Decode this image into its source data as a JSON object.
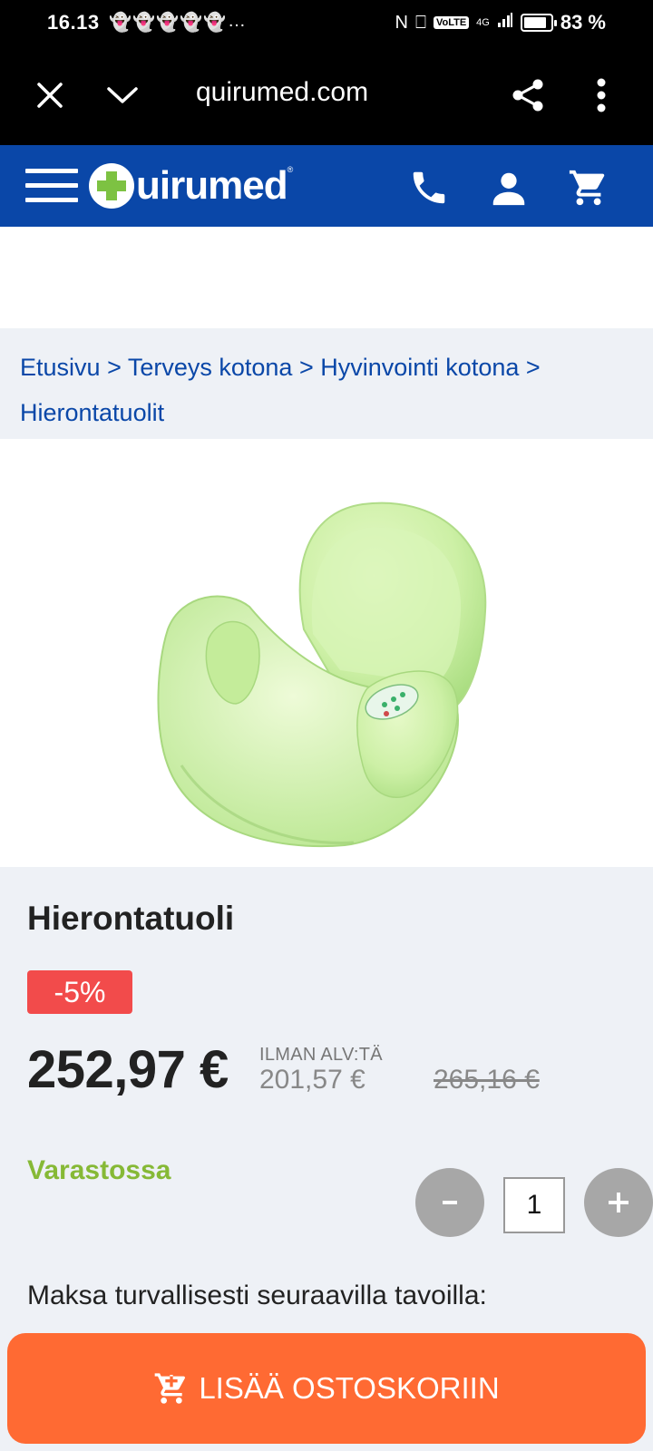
{
  "status_bar": {
    "time": "16.13",
    "network": "4G",
    "volte": "VoLTE",
    "battery_pct": "83 %"
  },
  "browser": {
    "url": "quirumed.com"
  },
  "site": {
    "logo_text": "uirumed",
    "brand_color": "#0a47a8",
    "logo_plus_color": "#7dc242"
  },
  "breadcrumb": {
    "items": [
      "Etusivu",
      "Terveys kotona",
      "Hyvinvointi kotona",
      "Hierontatuolit"
    ],
    "separator": ">"
  },
  "product": {
    "title": "Hierontatuoli",
    "discount_badge": "-5%",
    "price": "252,97 €",
    "vat_label": "ILMAN ALV:TÄ",
    "price_without_vat": "201,57 €",
    "old_price": "265,16 €",
    "stock_status": "Varastossa",
    "quantity": "1",
    "payment_text": "Maksa turvallisesti seuraavilla tavoilla:"
  },
  "cart_button": {
    "label": "LISÄÄ OSTOSKORIIN",
    "color": "#ff6a33"
  }
}
